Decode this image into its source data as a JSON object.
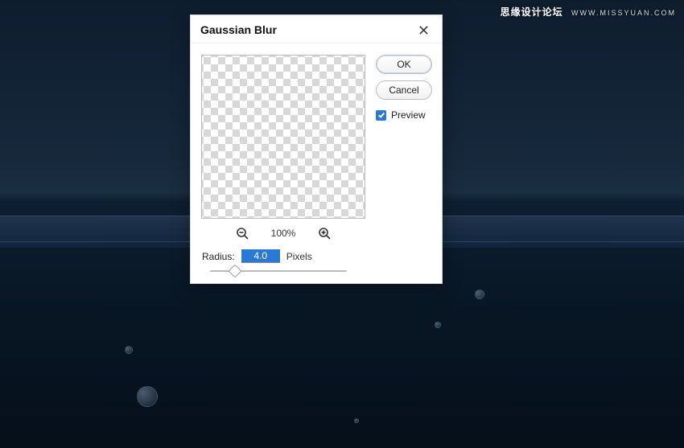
{
  "watermark": {
    "main": "思缘设计论坛",
    "sub": "WWW.MISSYUAN.COM"
  },
  "dialog": {
    "title": "Gaussian Blur",
    "zoom_percent": "100%",
    "radius_label": "Radius:",
    "radius_value": "4.0",
    "radius_unit": "Pixels",
    "buttons": {
      "ok": "OK",
      "cancel": "Cancel"
    },
    "preview_label": "Preview",
    "preview_checked": true
  }
}
